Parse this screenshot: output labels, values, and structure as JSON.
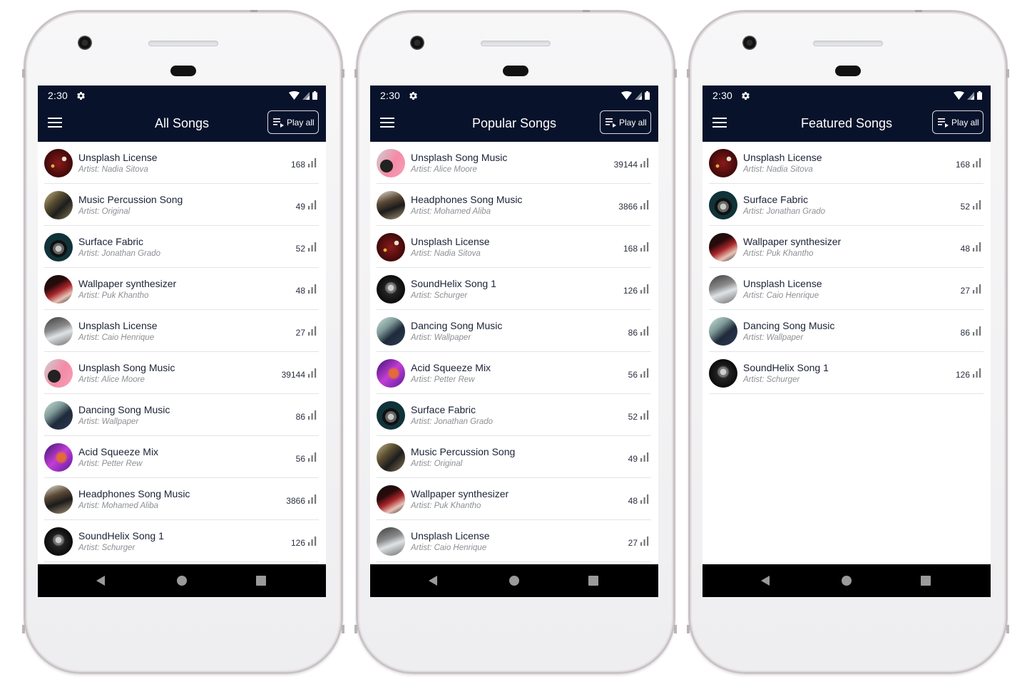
{
  "colors": {
    "appbar_bg": "#08122b",
    "text_primary": "#1b2236",
    "text_secondary": "#8d8f95",
    "navbar_bg": "#000000"
  },
  "status": {
    "time": "2:30",
    "icons": [
      "gear-icon",
      "wifi-icon",
      "signal-icon",
      "battery-icon"
    ]
  },
  "phones": [
    {
      "title": "All Songs",
      "play_all_label": "Play all",
      "songs": [
        {
          "title": "Unsplash License",
          "artist": "Artist:  Nadia Sitova",
          "plays": "168",
          "art": "red"
        },
        {
          "title": "Music Percussion Song",
          "artist": "Artist:  Original",
          "plays": "49",
          "art": "sax"
        },
        {
          "title": "Surface Fabric",
          "artist": "Artist:  Jonathan Grado",
          "plays": "52",
          "art": "disc"
        },
        {
          "title": "Wallpaper synthesizer",
          "artist": "Artist:  Puk Khantho",
          "plays": "48",
          "art": "synth"
        },
        {
          "title": "Unsplash License",
          "artist": "Artist:  Caio Henrique",
          "plays": "27",
          "art": "guitar"
        },
        {
          "title": "Unsplash Song Music",
          "artist": "Artist:  Alice Moore",
          "plays": "39144",
          "art": "pink"
        },
        {
          "title": "Dancing Song Music",
          "artist": "Artist:  Wallpaper",
          "plays": "86",
          "art": "bass"
        },
        {
          "title": "Acid Squeeze Mix",
          "artist": "Artist:  Petter Rew",
          "plays": "56",
          "art": "purple"
        },
        {
          "title": "Headphones Song Music",
          "artist": "Artist:  Mohamed Aliba",
          "plays": "3866",
          "art": "studio"
        },
        {
          "title": "SoundHelix Song 1",
          "artist": "Artist:  Schurger",
          "plays": "126",
          "art": "dark"
        }
      ]
    },
    {
      "title": "Popular Songs",
      "play_all_label": "Play all",
      "songs": [
        {
          "title": "Unsplash Song Music",
          "artist": "Artist:  Alice Moore",
          "plays": "39144",
          "art": "pink"
        },
        {
          "title": "Headphones Song Music",
          "artist": "Artist:  Mohamed Aliba",
          "plays": "3866",
          "art": "studio"
        },
        {
          "title": "Unsplash License",
          "artist": "Artist:  Nadia Sitova",
          "plays": "168",
          "art": "red"
        },
        {
          "title": "SoundHelix Song 1",
          "artist": "Artist:  Schurger",
          "plays": "126",
          "art": "dark"
        },
        {
          "title": "Dancing Song Music",
          "artist": "Artist:  Wallpaper",
          "plays": "86",
          "art": "bass"
        },
        {
          "title": "Acid Squeeze Mix",
          "artist": "Artist:  Petter Rew",
          "plays": "56",
          "art": "purple"
        },
        {
          "title": "Surface Fabric",
          "artist": "Artist:  Jonathan Grado",
          "plays": "52",
          "art": "disc"
        },
        {
          "title": "Music Percussion Song",
          "artist": "Artist:  Original",
          "plays": "49",
          "art": "sax"
        },
        {
          "title": "Wallpaper synthesizer",
          "artist": "Artist:  Puk Khantho",
          "plays": "48",
          "art": "synth"
        },
        {
          "title": "Unsplash License",
          "artist": "Artist:  Caio Henrique",
          "plays": "27",
          "art": "guitar"
        }
      ]
    },
    {
      "title": "Featured Songs",
      "play_all_label": "Play all",
      "songs": [
        {
          "title": "Unsplash License",
          "artist": "Artist:  Nadia Sitova",
          "plays": "168",
          "art": "red"
        },
        {
          "title": "Surface Fabric",
          "artist": "Artist:  Jonathan Grado",
          "plays": "52",
          "art": "disc"
        },
        {
          "title": "Wallpaper synthesizer",
          "artist": "Artist:  Puk Khantho",
          "plays": "48",
          "art": "synth"
        },
        {
          "title": "Unsplash License",
          "artist": "Artist:  Caio Henrique",
          "plays": "27",
          "art": "guitar"
        },
        {
          "title": "Dancing Song Music",
          "artist": "Artist:  Wallpaper",
          "plays": "86",
          "art": "bass"
        },
        {
          "title": "SoundHelix Song 1",
          "artist": "Artist:  Schurger",
          "plays": "126",
          "art": "dark"
        }
      ]
    }
  ]
}
